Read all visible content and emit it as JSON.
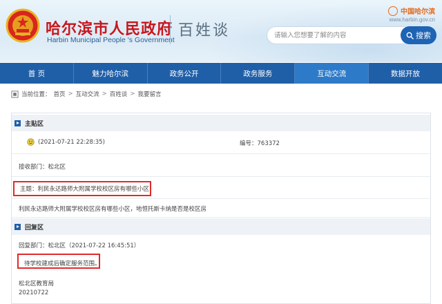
{
  "header": {
    "site_title": "哈尔滨市人民政府",
    "site_subtitle": "Harbin Municipal People 's Government",
    "section_name": "百姓谈",
    "brand_text": "中国哈尔滨",
    "brand_url": "www.harbin.gov.cn"
  },
  "search": {
    "placeholder": "请输入您想要了解的内容",
    "button_label": "搜索"
  },
  "nav": {
    "items": [
      {
        "label": "首 页"
      },
      {
        "label": "魅力哈尔滨"
      },
      {
        "label": "政务公开"
      },
      {
        "label": "政务服务"
      },
      {
        "label": "互动交流"
      },
      {
        "label": "数据开放"
      }
    ]
  },
  "breadcrumb": {
    "prefix": "当前位置：",
    "items": [
      "首页",
      "互动交流",
      "百姓谈",
      "我要留言"
    ],
    "separator": ">"
  },
  "main_post": {
    "section_label": "主贴区",
    "timestamp": "(2021-07-21 22:28:35)",
    "number_text": "编号：763372",
    "department_text": "接收部门：松北区",
    "subject_text": "主题：利民永达路师大附属学校校区房有哪些小区",
    "body_text": "利民永达路师大附属学校校区房有哪些小区，地恒托斯卡纳是否是校区房"
  },
  "reply": {
    "section_label": "回复区",
    "department_line": "回复部门：松北区（2021-07-22 16:45:51）",
    "content_text": "待学校建成后确定服务范围。",
    "signer": "松北区教育局",
    "date": "20210722"
  },
  "colors": {
    "title_red": "#c8161d",
    "nav_blue": "#1f5fa8",
    "nav_active": "#2d7ac8",
    "highlight_red": "#e02a2a"
  }
}
